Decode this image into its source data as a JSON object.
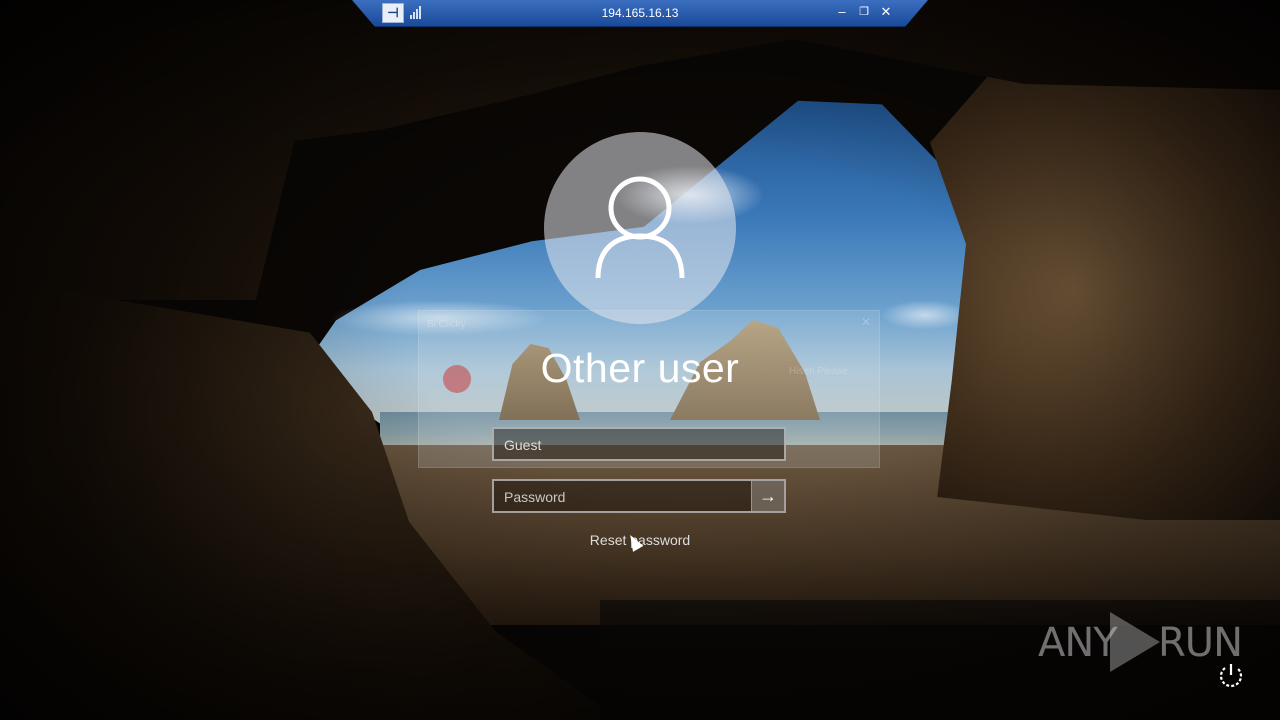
{
  "remote_bar": {
    "title": "194.165.16.13",
    "pin_label": "⊣",
    "minimize": "–",
    "restore": "❐",
    "close": "✕"
  },
  "ghost_dialog": {
    "title": "Bi Clicky",
    "close": "✕",
    "text": "Hisen Please"
  },
  "login": {
    "username_heading": "Other user",
    "user_field_value": "Guest",
    "password_placeholder": "Password",
    "submit_arrow": "→",
    "reset_link": "Reset password"
  },
  "watermark": {
    "left": "ANY",
    "right": "RUN"
  }
}
